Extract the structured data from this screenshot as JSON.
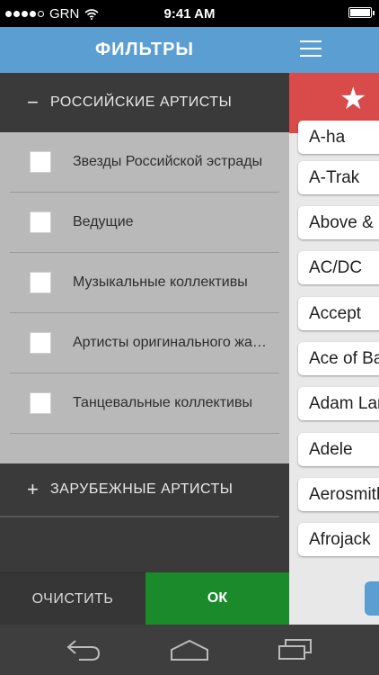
{
  "status_bar": {
    "carrier": "GRN",
    "time": "9:41 AM"
  },
  "panel": {
    "title": "ФИЛЬТРЫ",
    "section_expanded": {
      "sign": "−",
      "label": "РОССИЙСКИЕ АРТИСТЫ"
    },
    "items": [
      {
        "label": "Звезды Российской эстрады",
        "checked": false
      },
      {
        "label": "Ведущие",
        "checked": false
      },
      {
        "label": "Музыкальные коллективы",
        "checked": false
      },
      {
        "label": "Артисты оригинального жанра",
        "checked": false
      },
      {
        "label": "Танцевальные коллективы",
        "checked": false
      }
    ],
    "section_collapsed": {
      "sign": "+",
      "label": "ЗАРУБЕЖНЫЕ АРТИСТЫ"
    },
    "clear_button": "ОЧИСТИТЬ",
    "ok_button": "ОК"
  },
  "artists": [
    "A-ha",
    "A-Trak",
    "Above & Beyond",
    "AC/DC",
    "Accept",
    "Ace of Base",
    "Adam Lambert",
    "Adele",
    "Aerosmith",
    "Afrojack"
  ],
  "colors": {
    "header_blue": "#5b9fd2",
    "favorites_red": "#d94a4a",
    "ok_green": "#1a8a2a"
  },
  "icons": {
    "menu": "hamburger-icon",
    "favorites": "star-icon",
    "back": "back-icon",
    "home": "home-icon",
    "recent": "recent-apps-icon"
  }
}
